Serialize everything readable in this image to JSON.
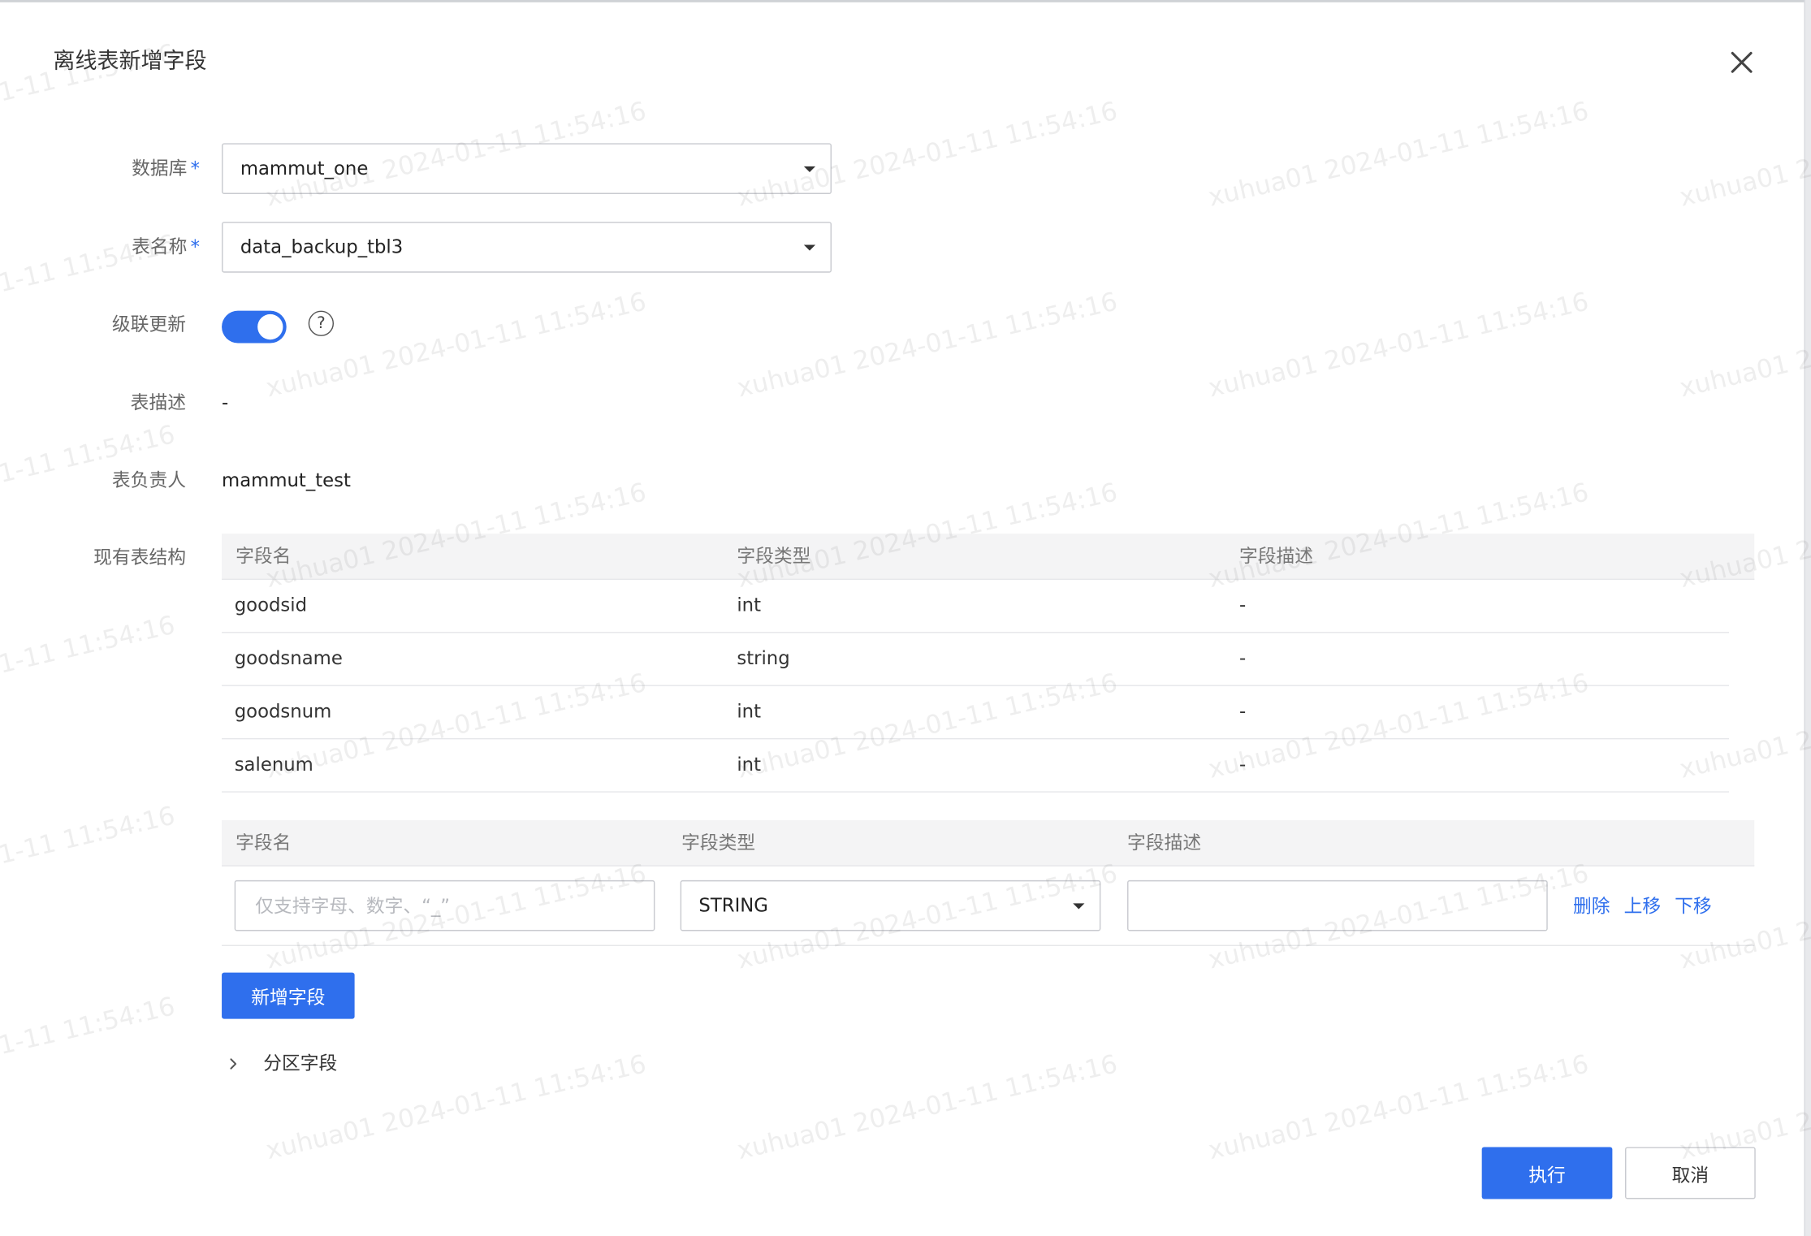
{
  "dialog": {
    "title": "离线表新增字段"
  },
  "form": {
    "database": {
      "label": "数据库",
      "required_mark": "*",
      "value": "mammut_one"
    },
    "table_name": {
      "label": "表名称",
      "required_mark": "*",
      "value": "data_backup_tbl3"
    },
    "cascade_update": {
      "label": "级联更新",
      "enabled": true,
      "help": "?"
    },
    "table_desc": {
      "label": "表描述",
      "value": "-"
    },
    "table_owner": {
      "label": "表负责人",
      "value": "mammut_test"
    },
    "structure": {
      "label": "现有表结构"
    }
  },
  "existing_table": {
    "columns": [
      "字段名",
      "字段类型",
      "字段描述"
    ],
    "rows": [
      {
        "name": "goodsid",
        "type": "int",
        "desc": "-"
      },
      {
        "name": "goodsname",
        "type": "string",
        "desc": "-"
      },
      {
        "name": "goodsnum",
        "type": "int",
        "desc": "-"
      },
      {
        "name": "salenum",
        "type": "int",
        "desc": "-"
      }
    ]
  },
  "new_fields": {
    "columns": [
      "字段名",
      "字段类型",
      "字段描述"
    ],
    "row": {
      "name_value": "",
      "name_placeholder": "仅支持字母、数字、“_”",
      "type_value": "STRING",
      "desc_value": "",
      "actions": [
        "删除",
        "上移",
        "下移"
      ]
    },
    "add_button": "新增字段"
  },
  "partition": {
    "label": "分区字段",
    "expanded": false
  },
  "footer": {
    "execute_label": "执行",
    "cancel_label": "取消"
  },
  "watermark": {
    "text": "xuhua01 2024-01-11 11:54:16"
  },
  "colors": {
    "accent": "#2f6fed"
  }
}
